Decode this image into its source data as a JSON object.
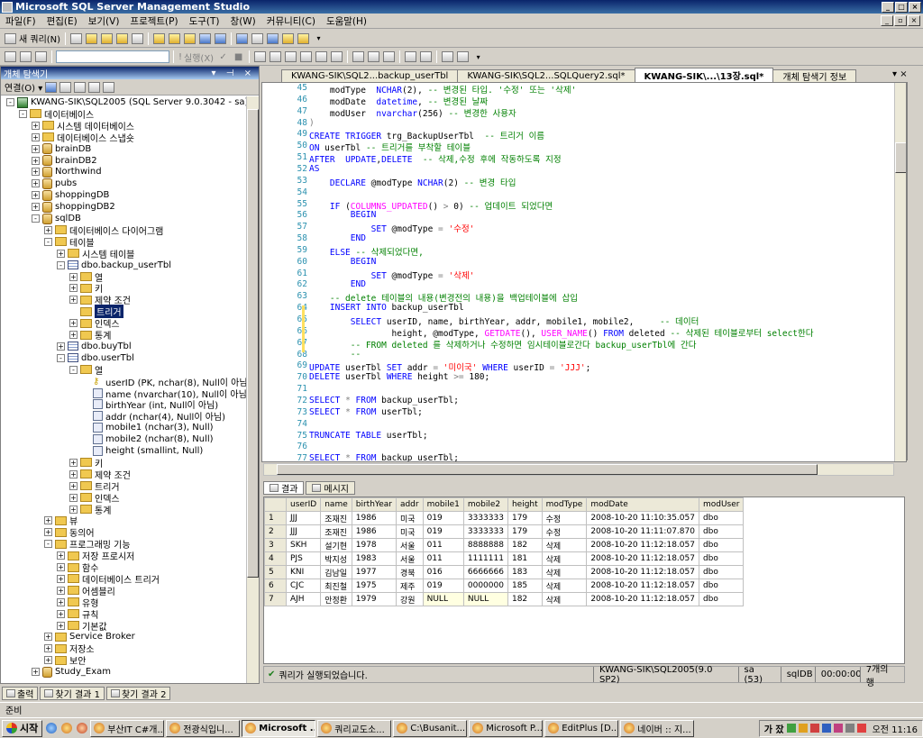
{
  "window": {
    "title": "Microsoft SQL Server Management Studio"
  },
  "menu": [
    "파일(F)",
    "편집(E)",
    "보기(V)",
    "프로젝트(P)",
    "도구(T)",
    "창(W)",
    "커뮤니티(C)",
    "도움말(H)"
  ],
  "toolbar": {
    "new_query": "새 쿼리(N)",
    "execute": "실행(X)"
  },
  "explorer": {
    "title": "개체 탐색기",
    "connect": "연결(O)",
    "tree": [
      {
        "level": 0,
        "exp": "-",
        "icon": "server-icon",
        "label": "KWANG-SIK\\SQL2005 (SQL Server 9.0.3042 - sa)"
      },
      {
        "level": 1,
        "exp": "-",
        "icon": "folder-icon",
        "label": "데이터베이스"
      },
      {
        "level": 2,
        "exp": "+",
        "icon": "folder-icon",
        "label": "시스템 데이터베이스"
      },
      {
        "level": 2,
        "exp": "+",
        "icon": "folder-icon",
        "label": "데이터베이스 스냅숏"
      },
      {
        "level": 2,
        "exp": "+",
        "icon": "database-icon",
        "label": "brainDB"
      },
      {
        "level": 2,
        "exp": "+",
        "icon": "database-icon",
        "label": "brainDB2"
      },
      {
        "level": 2,
        "exp": "+",
        "icon": "database-icon",
        "label": "Northwind"
      },
      {
        "level": 2,
        "exp": "+",
        "icon": "database-icon",
        "label": "pubs"
      },
      {
        "level": 2,
        "exp": "+",
        "icon": "database-icon",
        "label": "shoppingDB"
      },
      {
        "level": 2,
        "exp": "+",
        "icon": "database-icon",
        "label": "shoppingDB2"
      },
      {
        "level": 2,
        "exp": "-",
        "icon": "database-icon",
        "label": "sqlDB"
      },
      {
        "level": 3,
        "exp": "+",
        "icon": "folder-icon",
        "label": "데이터베이스 다이어그램"
      },
      {
        "level": 3,
        "exp": "-",
        "icon": "folder-icon",
        "label": "테이블"
      },
      {
        "level": 4,
        "exp": "+",
        "icon": "folder-icon",
        "label": "시스템 테이블"
      },
      {
        "level": 4,
        "exp": "-",
        "icon": "table-icon",
        "label": "dbo.backup_userTbl"
      },
      {
        "level": 5,
        "exp": "+",
        "icon": "folder-icon",
        "label": "열"
      },
      {
        "level": 5,
        "exp": "+",
        "icon": "folder-icon",
        "label": "키"
      },
      {
        "level": 5,
        "exp": "+",
        "icon": "folder-icon",
        "label": "제약 조건"
      },
      {
        "level": 5,
        "exp": "",
        "icon": "folder-icon",
        "label": "트리거",
        "selected": true
      },
      {
        "level": 5,
        "exp": "+",
        "icon": "folder-icon",
        "label": "인덱스"
      },
      {
        "level": 5,
        "exp": "+",
        "icon": "folder-icon",
        "label": "통계"
      },
      {
        "level": 4,
        "exp": "+",
        "icon": "table-icon",
        "label": "dbo.buyTbl"
      },
      {
        "level": 4,
        "exp": "-",
        "icon": "table-icon",
        "label": "dbo.userTbl"
      },
      {
        "level": 5,
        "exp": "-",
        "icon": "folder-icon",
        "label": "열"
      },
      {
        "level": 6,
        "exp": "",
        "icon": "key-icon",
        "label": "userID (PK, nchar(8), Null이 아님"
      },
      {
        "level": 6,
        "exp": "",
        "icon": "column-icon",
        "label": "name (nvarchar(10), Null이 아님"
      },
      {
        "level": 6,
        "exp": "",
        "icon": "column-icon",
        "label": "birthYear (int, Null이 아님)"
      },
      {
        "level": 6,
        "exp": "",
        "icon": "column-icon",
        "label": "addr (nchar(4), Null이 아님)"
      },
      {
        "level": 6,
        "exp": "",
        "icon": "column-icon",
        "label": "mobile1 (nchar(3), Null)"
      },
      {
        "level": 6,
        "exp": "",
        "icon": "column-icon",
        "label": "mobile2 (nchar(8), Null)"
      },
      {
        "level": 6,
        "exp": "",
        "icon": "column-icon",
        "label": "height (smallint, Null)"
      },
      {
        "level": 5,
        "exp": "+",
        "icon": "folder-icon",
        "label": "키"
      },
      {
        "level": 5,
        "exp": "+",
        "icon": "folder-icon",
        "label": "제약 조건"
      },
      {
        "level": 5,
        "exp": "+",
        "icon": "folder-icon",
        "label": "트리거"
      },
      {
        "level": 5,
        "exp": "+",
        "icon": "folder-icon",
        "label": "인덱스"
      },
      {
        "level": 5,
        "exp": "+",
        "icon": "folder-icon",
        "label": "통계"
      },
      {
        "level": 3,
        "exp": "+",
        "icon": "folder-icon",
        "label": "뷰"
      },
      {
        "level": 3,
        "exp": "+",
        "icon": "folder-icon",
        "label": "동의어"
      },
      {
        "level": 3,
        "exp": "-",
        "icon": "folder-icon",
        "label": "프로그래밍 기능"
      },
      {
        "level": 4,
        "exp": "+",
        "icon": "folder-icon",
        "label": "저장 프로시저"
      },
      {
        "level": 4,
        "exp": "+",
        "icon": "folder-icon",
        "label": "함수"
      },
      {
        "level": 4,
        "exp": "+",
        "icon": "folder-icon",
        "label": "데이터베이스 트리거"
      },
      {
        "level": 4,
        "exp": "+",
        "icon": "folder-icon",
        "label": "어셈블리"
      },
      {
        "level": 4,
        "exp": "+",
        "icon": "folder-icon",
        "label": "유형"
      },
      {
        "level": 4,
        "exp": "+",
        "icon": "folder-icon",
        "label": "규칙"
      },
      {
        "level": 4,
        "exp": "+",
        "icon": "folder-icon",
        "label": "기본값"
      },
      {
        "level": 3,
        "exp": "+",
        "icon": "folder-icon",
        "label": "Service Broker"
      },
      {
        "level": 3,
        "exp": "+",
        "icon": "folder-icon",
        "label": "저장소"
      },
      {
        "level": 3,
        "exp": "+",
        "icon": "folder-icon",
        "label": "보안"
      },
      {
        "level": 2,
        "exp": "+",
        "icon": "database-icon",
        "label": "Study_Exam"
      }
    ]
  },
  "tabs": [
    {
      "label": "KWANG-SIK\\SQL2...backup_userTbl",
      "active": false
    },
    {
      "label": "KWANG-SIK\\SQL2...SQLQuery2.sql*",
      "active": false
    },
    {
      "label": "KWANG-SIK\\...\\13장.sql*",
      "active": true
    },
    {
      "label": "개체 탐색기 정보",
      "active": false
    }
  ],
  "code_lines": [
    {
      "n": "45",
      "html": "    modType  <span class='kw'>NCHAR</span>(2), <span class='cm'>-- 변경된 타입. '수정' 또는 '삭제'</span>"
    },
    {
      "n": "46",
      "html": "    modDate  <span class='kw'>datetime</span>, <span class='cm'>-- 변경된 날짜</span>"
    },
    {
      "n": "47",
      "html": "    modUser  <span class='kw'>nvarchar</span>(256) <span class='cm'>-- 변경한 사용자</span>"
    },
    {
      "n": "48",
      "html": "<span class='gray'>)</span>"
    },
    {
      "n": "49",
      "html": "<span class='kw'>CREATE TRIGGER</span> trg_BackupUserTbl  <span class='cm'>-- 트리거 이름</span>"
    },
    {
      "n": "50",
      "html": "<span class='kw'>ON</span> userTbl <span class='cm'>-- 트리거를 부착할 테이블</span>"
    },
    {
      "n": "51",
      "html": "<span class='kw'>AFTER</span>  <span class='kw'>UPDATE</span>,<span class='kw'>DELETE</span>  <span class='cm'>-- 삭제,수정 후에 작동하도록 지정</span>"
    },
    {
      "n": "52",
      "html": "<span class='kw'>AS</span>"
    },
    {
      "n": "53",
      "html": "    <span class='kw'>DECLARE</span> @modType <span class='kw'>NCHAR</span>(2) <span class='cm'>-- 변경 타입</span>"
    },
    {
      "n": "54",
      "html": ""
    },
    {
      "n": "55",
      "html": "    <span class='kw'>IF</span> (<span class='fn'>COLUMNS_UPDATED</span>() <span class='gray'>&gt;</span> 0) <span class='cm'>-- 업데이트 되었다면</span>"
    },
    {
      "n": "56",
      "html": "        <span class='kw'>BEGIN</span>"
    },
    {
      "n": "57",
      "html": "            <span class='kw'>SET</span> @modType <span class='gray'>=</span> <span class='str'>'수정'</span>"
    },
    {
      "n": "58",
      "html": "        <span class='kw'>END</span>"
    },
    {
      "n": "59",
      "html": "    <span class='kw'>ELSE</span> <span class='cm'>-- 삭제되었다면,</span>"
    },
    {
      "n": "60",
      "html": "        <span class='kw'>BEGIN</span>"
    },
    {
      "n": "61",
      "html": "            <span class='kw'>SET</span> @modType <span class='gray'>=</span> <span class='str'>'삭제'</span>"
    },
    {
      "n": "62",
      "html": "        <span class='kw'>END</span>"
    },
    {
      "n": "63",
      "html": "    <span class='cm'>-- delete 테이블의 내용(변경전의 내용)을 백업테이블에 삽입</span>"
    },
    {
      "n": "64",
      "html": "    <span class='kw'>INSERT INTO</span> backup_userTbl"
    },
    {
      "n": "65",
      "html": "        <span class='kw'>SELECT</span> userID, name, birthYear, addr, mobile1, mobile2,     <span class='cm'>-- 데이터</span>"
    },
    {
      "n": "66",
      "html": "                height, @modType, <span class='fn'>GETDATE</span>(), <span class='fn'>USER_NAME</span>() <span class='kw'>FROM</span> deleted <span class='cm'>-- 삭제된 테이블로부터 select한다</span>"
    },
    {
      "n": "67",
      "html": "        <span class='cm'>-- FROM deleted 를 삭제하거나 수정하면 임시테이블로간다 backup_userTbl에 간다</span>"
    },
    {
      "n": "68",
      "html": "        <span class='cm'>--</span>"
    },
    {
      "n": "69",
      "html": "<span class='kw'>UPDATE</span> userTbl <span class='kw'>SET</span> addr <span class='gray'>=</span> <span class='str'>'미이국'</span> <span class='kw'>WHERE</span> userID <span class='gray'>=</span> <span class='str'>'JJJ'</span>;"
    },
    {
      "n": "70",
      "html": "<span class='kw'>DELETE</span> userTbl <span class='kw'>WHERE</span> height <span class='gray'>&gt;=</span> 180;"
    },
    {
      "n": "71",
      "html": ""
    },
    {
      "n": "72",
      "html": "<span class='kw'>SELECT</span> <span class='gray'>*</span> <span class='kw'>FROM</span> backup_userTbl;"
    },
    {
      "n": "73",
      "html": "<span class='kw'>SELECT</span> <span class='gray'>*</span> <span class='kw'>FROM</span> userTbl;"
    },
    {
      "n": "74",
      "html": ""
    },
    {
      "n": "75",
      "html": "<span class='kw'>TRUNCATE TABLE</span> userTbl;"
    },
    {
      "n": "76",
      "html": ""
    },
    {
      "n": "77",
      "html": "<span class='kw'>SELECT</span> <span class='gray'>*</span> <span class='kw'>FROM</span> backup_userTbl;"
    }
  ],
  "results": {
    "tab_results": "결과",
    "tab_messages": "메시지",
    "columns": [
      "userID",
      "name",
      "birthYear",
      "addr",
      "mobile1",
      "mobile2",
      "height",
      "modType",
      "modDate",
      "modUser"
    ],
    "rows": [
      [
        "1",
        "JJJ",
        "조재진",
        "1986",
        "미국",
        "019",
        "3333333",
        "179",
        "수정",
        "2008-10-20 11:10:35.057",
        "dbo"
      ],
      [
        "2",
        "JJJ",
        "조재진",
        "1986",
        "미국",
        "019",
        "3333333",
        "179",
        "수정",
        "2008-10-20 11:11:07.870",
        "dbo"
      ],
      [
        "3",
        "SKH",
        "설기현",
        "1978",
        "서울",
        "011",
        "8888888",
        "182",
        "삭제",
        "2008-10-20 11:12:18.057",
        "dbo"
      ],
      [
        "4",
        "PJS",
        "박지성",
        "1983",
        "서울",
        "011",
        "1111111",
        "181",
        "삭제",
        "2008-10-20 11:12:18.057",
        "dbo"
      ],
      [
        "5",
        "KNI",
        "김남일",
        "1977",
        "경북",
        "016",
        "6666666",
        "183",
        "삭제",
        "2008-10-20 11:12:18.057",
        "dbo"
      ],
      [
        "6",
        "CJC",
        "최진철",
        "1975",
        "제주",
        "019",
        "0000000",
        "185",
        "삭제",
        "2008-10-20 11:12:18.057",
        "dbo"
      ],
      [
        "7",
        "AJH",
        "안정환",
        "1979",
        "강원",
        "NULL",
        "NULL",
        "182",
        "삭제",
        "2008-10-20 11:12:18.057",
        "dbo"
      ]
    ]
  },
  "query_status": {
    "message": "쿼리가 실행되었습니다.",
    "server": "KWANG-SIK\\SQL2005(9.0 SP2)",
    "user": "sa (53)",
    "db": "sqlDB",
    "time": "00:00:00",
    "rows": "7개의 행"
  },
  "bottom_tabs": [
    "출력",
    "찾기 결과 1",
    "찾기 결과 2"
  ],
  "status_bar": "준비",
  "taskbar": {
    "start": "시작",
    "items": [
      {
        "label": "부산IT C#개...",
        "active": false
      },
      {
        "label": "전광식입니...",
        "active": false
      },
      {
        "label": "Microsoft ...",
        "active": true
      },
      {
        "label": "쿼리교도소...",
        "active": false
      },
      {
        "label": "C:\\Busanit...",
        "active": false
      },
      {
        "label": "Microsoft P...",
        "active": false
      },
      {
        "label": "EditPlus [D...",
        "active": false
      },
      {
        "label": "네이버 :: 지...",
        "active": false
      }
    ],
    "ime": "가 잤",
    "clock": "오전 11:16"
  }
}
